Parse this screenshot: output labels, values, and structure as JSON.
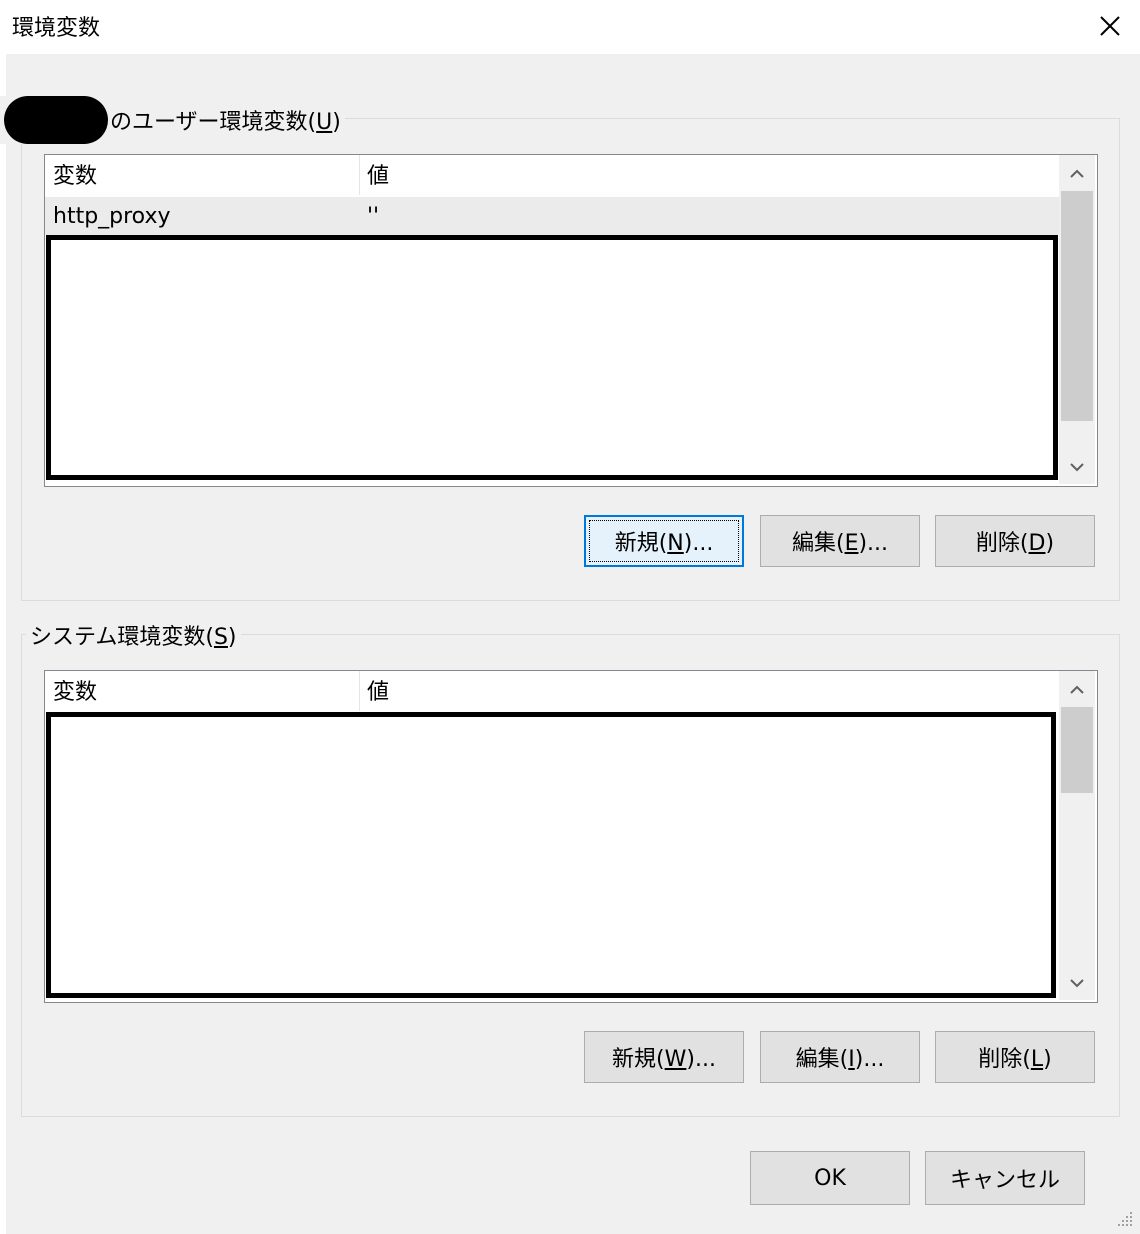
{
  "window": {
    "title": "環境変数"
  },
  "user_group": {
    "label": "のユーザー環境変数(U)",
    "columns": [
      "変数",
      "値"
    ],
    "rows": [
      {
        "variable": "http_proxy",
        "value": "''"
      }
    ],
    "buttons": {
      "new": "新規(N)...",
      "edit": "編集(E)...",
      "delete": "削除(D)"
    }
  },
  "system_group": {
    "label": "システム環境変数(S)",
    "columns": [
      "変数",
      "値"
    ],
    "buttons": {
      "new": "新規(W)...",
      "edit": "編集(I)...",
      "delete": "削除(L)"
    }
  },
  "footer": {
    "ok": "OK",
    "cancel": "キャンセル"
  },
  "icons": [
    "close-icon",
    "chevron-up-icon",
    "chevron-down-icon",
    "resize-grip-icon"
  ]
}
